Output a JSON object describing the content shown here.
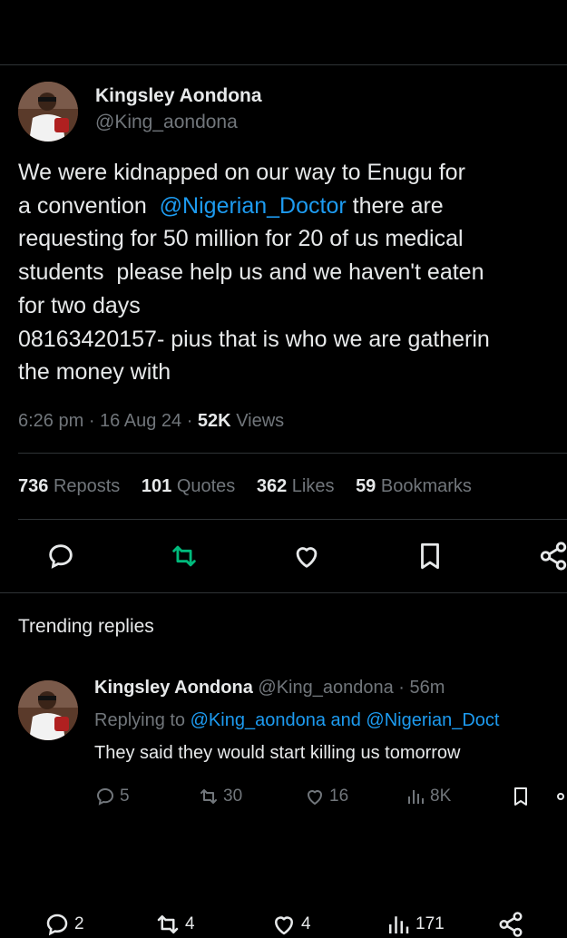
{
  "tweet": {
    "author_name": "Kingsley Aondona",
    "author_handle": "@King_aondona",
    "body": {
      "line1": "We were kidnapped on our way to Enugu for",
      "line2_pre": "a convention  ",
      "line2_mention": "@Nigerian_Doctor",
      "line2_post": " there are",
      "line3": "requesting for 50 million for 20 of us medical",
      "line4": "students  please help us and we haven't eaten",
      "line5": "for two days",
      "line6": "08163420157- pius that is who we are gatherin",
      "line7": "the money with"
    },
    "time": "6:26 pm",
    "date": "16 Aug 24",
    "views_count": "52K",
    "views_label": "Views",
    "stats": {
      "reposts_count": "736",
      "reposts_label": "Reposts",
      "quotes_count": "101",
      "quotes_label": "Quotes",
      "likes_count": "362",
      "likes_label": "Likes",
      "bookmarks_count": "59",
      "bookmarks_label": "Bookmarks"
    }
  },
  "trending": {
    "title": "Trending replies"
  },
  "reply": {
    "author_name": "Kingsley Aondona",
    "author_handle": "@King_aondona",
    "time_ago": "56m",
    "replying_prefix": "Replying to ",
    "replying_mentions": "@King_aondona and @Nigerian_Doct",
    "text": "They said they would start killing us tomorrow",
    "replies": "5",
    "reposts": "30",
    "likes": "16",
    "views": "8K"
  },
  "next_reply": {
    "replies": "2",
    "reposts": "4",
    "likes": "4",
    "views": "171"
  },
  "colors": {
    "accent": "#1d9bf0",
    "repost_active": "#00ba7c",
    "muted": "#71767b"
  }
}
